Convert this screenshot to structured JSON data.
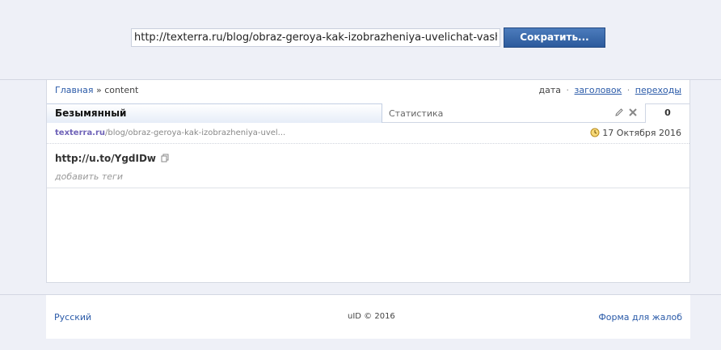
{
  "top": {
    "url_value": "http://texterra.ru/blog/obraz-geroya-kak-izobrazheniya-uvelichat-vash",
    "button_label": "Сократить..."
  },
  "breadcrumb": {
    "home": "Главная",
    "separator": "»",
    "current": "content"
  },
  "sort": {
    "date": "дата",
    "title": "заголовок",
    "clicks": "переходы",
    "separator": "·"
  },
  "tabs": {
    "active_label": "Безымянный",
    "stats_label": "Статистика",
    "count": "0"
  },
  "link": {
    "domain": "texterra.ru",
    "path": "/blog/obraz-geroya-kak-izobrazheniya-uvel...",
    "date": "17 Октября 2016",
    "short_url": "http://u.to/YgdIDw",
    "add_tags": "добавить теги"
  },
  "footer": {
    "language": "Русский",
    "copyright": "uID © 2016",
    "complaint": "Форма для жалоб"
  },
  "colors": {
    "accent": "#2c5a9c",
    "link": "#2a5aa8"
  }
}
